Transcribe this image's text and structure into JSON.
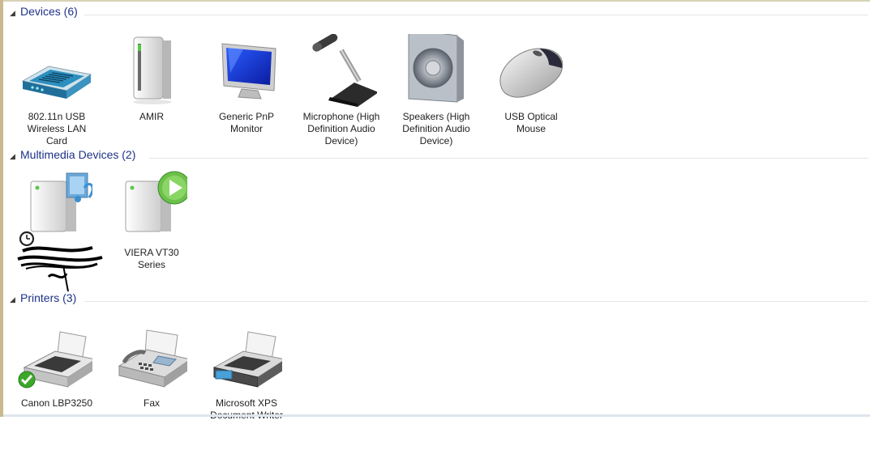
{
  "groups": [
    {
      "title": "Devices (6)",
      "items": [
        {
          "label": "802.11n USB Wireless LAN Card",
          "icon": "wireless-router-icon"
        },
        {
          "label": "AMIR",
          "icon": "computer-tower-icon"
        },
        {
          "label": "Generic PnP Monitor",
          "icon": "monitor-icon"
        },
        {
          "label": "Microphone (High Definition Audio Device)",
          "icon": "microphone-icon"
        },
        {
          "label": "Speakers (High Definition Audio Device)",
          "icon": "speaker-icon"
        },
        {
          "label": "USB Optical Mouse",
          "icon": "mouse-icon"
        }
      ]
    },
    {
      "title": "Multimedia Devices (2)",
      "items": [
        {
          "label": "",
          "icon": "media-server-icon"
        },
        {
          "label": "VIERA VT30 Series",
          "icon": "media-renderer-icon"
        }
      ]
    },
    {
      "title": "Printers (3)",
      "items": [
        {
          "label": "Canon LBP3250",
          "icon": "printer-icon"
        },
        {
          "label": "Fax",
          "icon": "fax-icon"
        },
        {
          "label": "Microsoft XPS Document Writer",
          "icon": "xps-printer-icon"
        }
      ]
    }
  ],
  "colors": {
    "group_title": "#1e3287",
    "default_badge": "#3ca82a",
    "play_badge": "#6cc04a"
  }
}
